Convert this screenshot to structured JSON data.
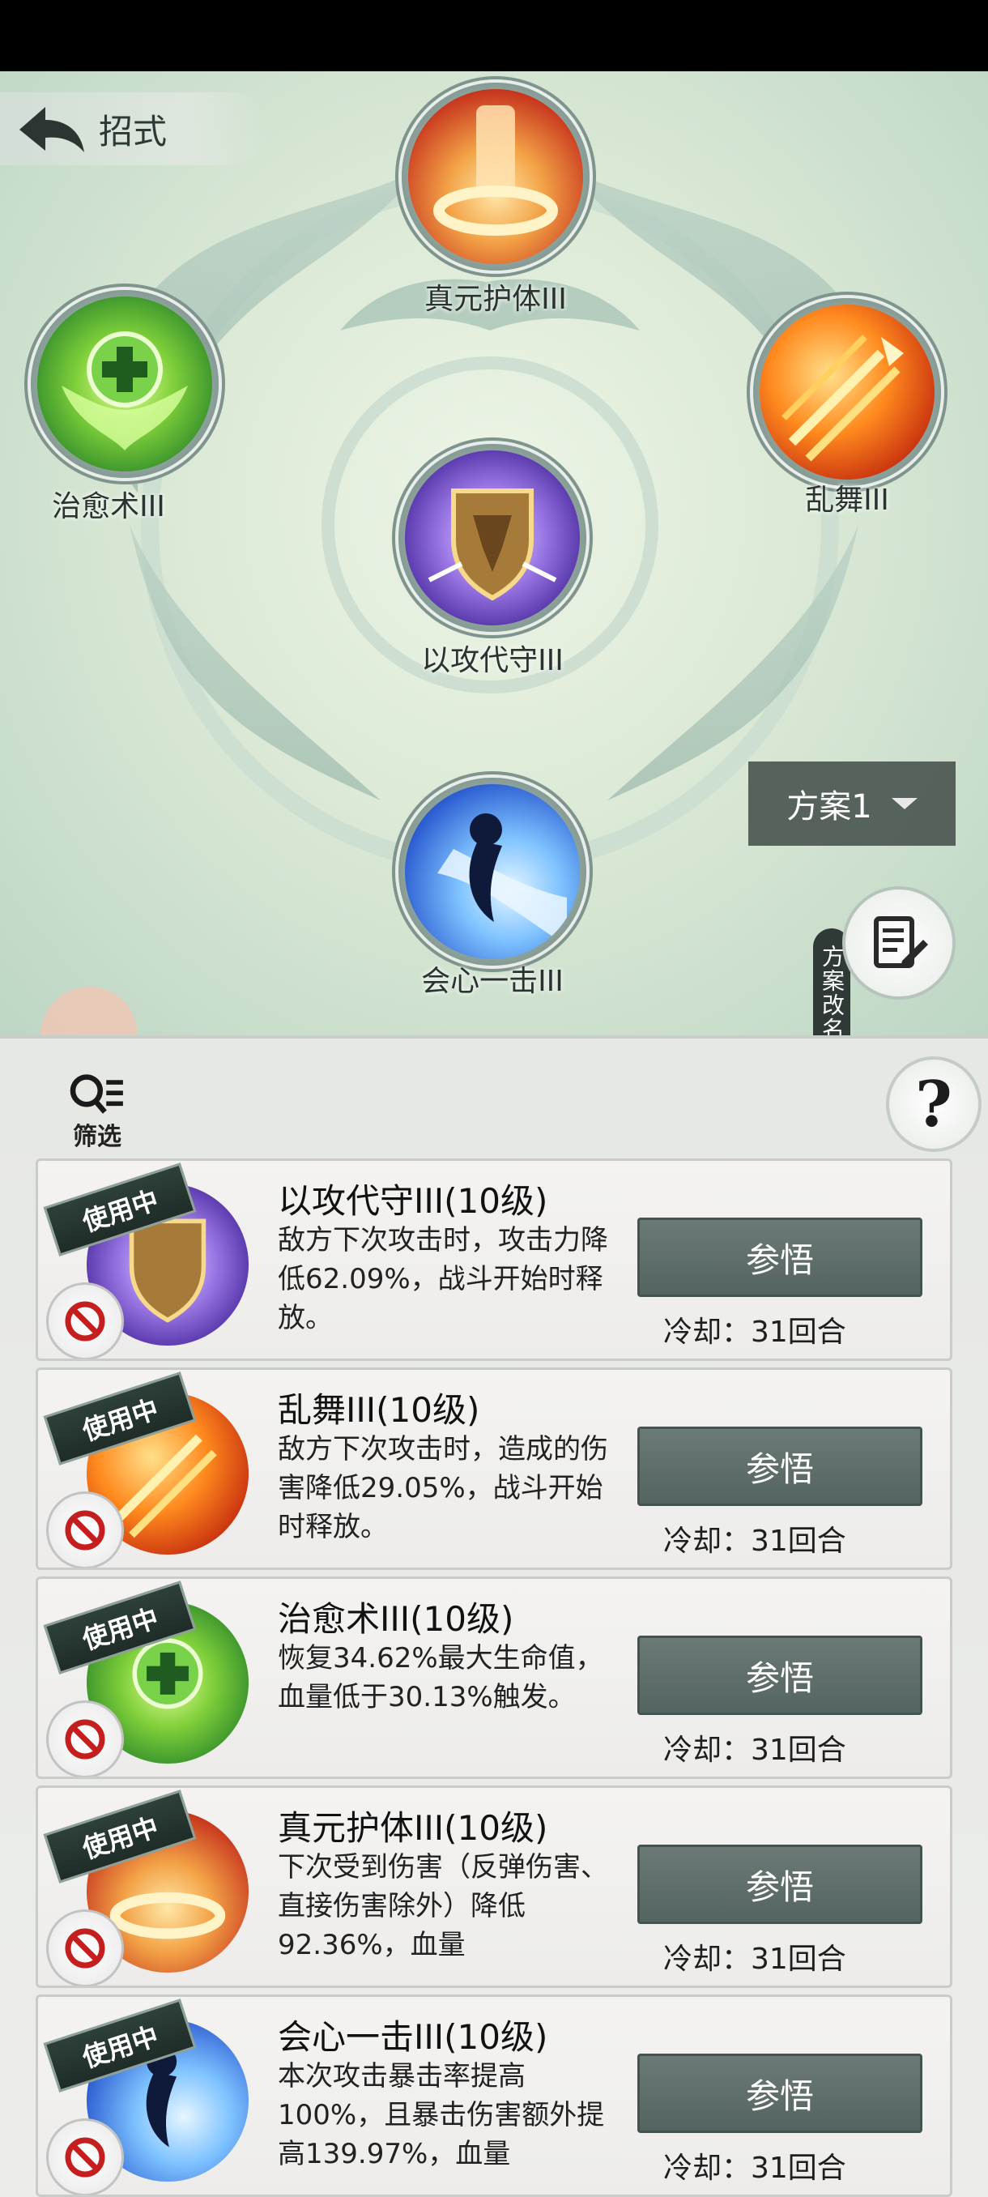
{
  "header": {
    "back_label": "招式"
  },
  "formation": {
    "nodes": [
      {
        "id": "top",
        "label": "真元护体III",
        "icon": "red-scroll-shield-icon"
      },
      {
        "id": "left",
        "label": "治愈术III",
        "icon": "green-heal-cross-icon"
      },
      {
        "id": "right",
        "label": "乱舞III",
        "icon": "orange-arrows-icon"
      },
      {
        "id": "center",
        "label": "以攻代守III",
        "icon": "purple-shield-icon"
      },
      {
        "id": "bottom",
        "label": "会心一击III",
        "icon": "blue-critical-strike-icon"
      }
    ],
    "plan_select": {
      "value": "方案1"
    },
    "rename": {
      "label": "方案改名"
    }
  },
  "panel": {
    "filter_label": "筛选",
    "help_label": "?",
    "skills": [
      {
        "title": "以攻代守III(10级)",
        "description": "敌方下次攻击时，攻击力降低62.09%，战斗开始时释放。",
        "status": "使用中",
        "action": "参悟",
        "cooldown": "冷却：31回合",
        "icon": "purple-shield-icon"
      },
      {
        "title": "乱舞III(10级)",
        "description": "敌方下次攻击时，造成的伤害降低29.05%，战斗开始时释放。",
        "status": "使用中",
        "action": "参悟",
        "cooldown": "冷却：31回合",
        "icon": "orange-arrows-icon"
      },
      {
        "title": "治愈术III(10级)",
        "description": "恢复34.62%最大生命值，血量低于30.13%触发。",
        "status": "使用中",
        "action": "参悟",
        "cooldown": "冷却：31回合",
        "icon": "green-heal-cross-icon"
      },
      {
        "title": "真元护体III(10级)",
        "description": "下次受到伤害（反弹伤害、直接伤害除外）降低92.36%，血量",
        "status": "使用中",
        "action": "参悟",
        "cooldown": "冷却：31回合",
        "icon": "red-scroll-shield-icon"
      },
      {
        "title": "会心一击III(10级)",
        "description": "本次攻击暴击率提高100%，且暴击伤害额外提高139.97%，血量",
        "status": "使用中",
        "action": "参悟",
        "cooldown": "冷却：31回合",
        "icon": "blue-critical-strike-icon"
      }
    ]
  }
}
